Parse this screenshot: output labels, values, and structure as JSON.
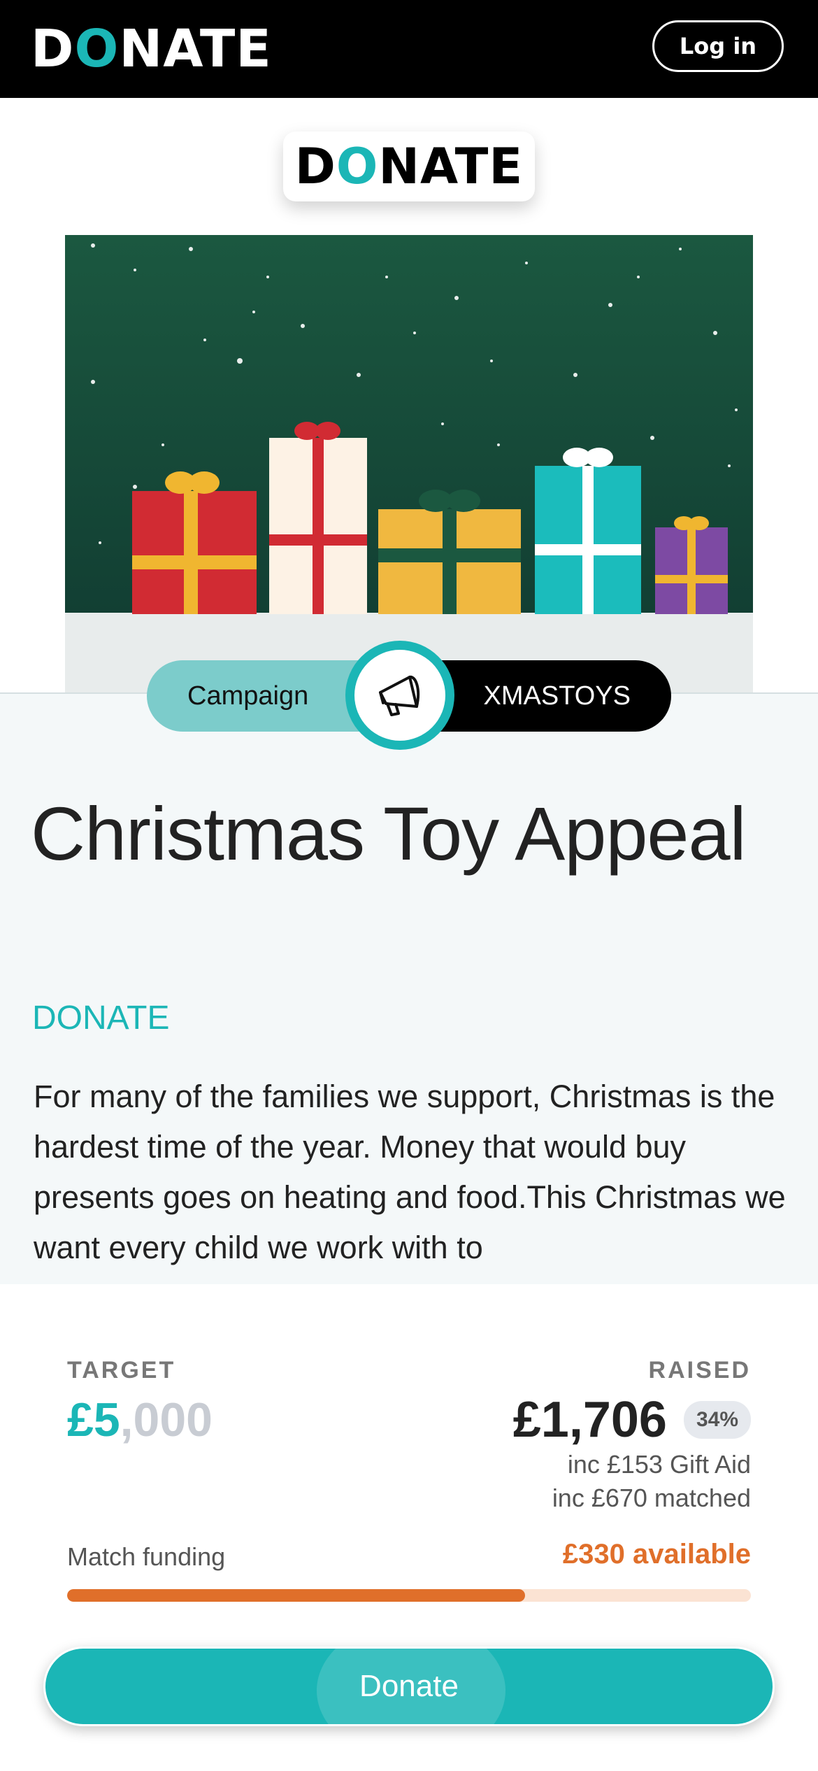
{
  "header": {
    "brand_pre": "D",
    "brand_o": "O",
    "brand_post": "NATE",
    "login_label": "Log in"
  },
  "logo": {
    "pre": "D",
    "o": "O",
    "post": "NATE"
  },
  "campaign": {
    "type_label": "Campaign",
    "code": "XMASTOYS",
    "icon": "megaphone-icon"
  },
  "title": "Christmas Toy Appeal",
  "organisation": "DONATE",
  "description": "For many of the families we support, Christmas is the hardest time of the year. Money that would buy presents goes on heating and food.This Christmas we want every child we work with to",
  "stats": {
    "target_label": "TARGET",
    "target_highlight": "£5",
    "target_rest": ",000",
    "raised_label": "RAISED",
    "raised_value": "£1,706",
    "raised_percent": "34%",
    "gift_aid": "inc £153 Gift Aid",
    "matched": "inc £670 matched"
  },
  "match_funding": {
    "label": "Match funding",
    "available": "£330 available",
    "progress": 0.67
  },
  "donate_label": "Donate",
  "colors": {
    "accent": "#1bb6b6",
    "match": "#e06f2a",
    "hero_bg": "#1d5a44"
  }
}
